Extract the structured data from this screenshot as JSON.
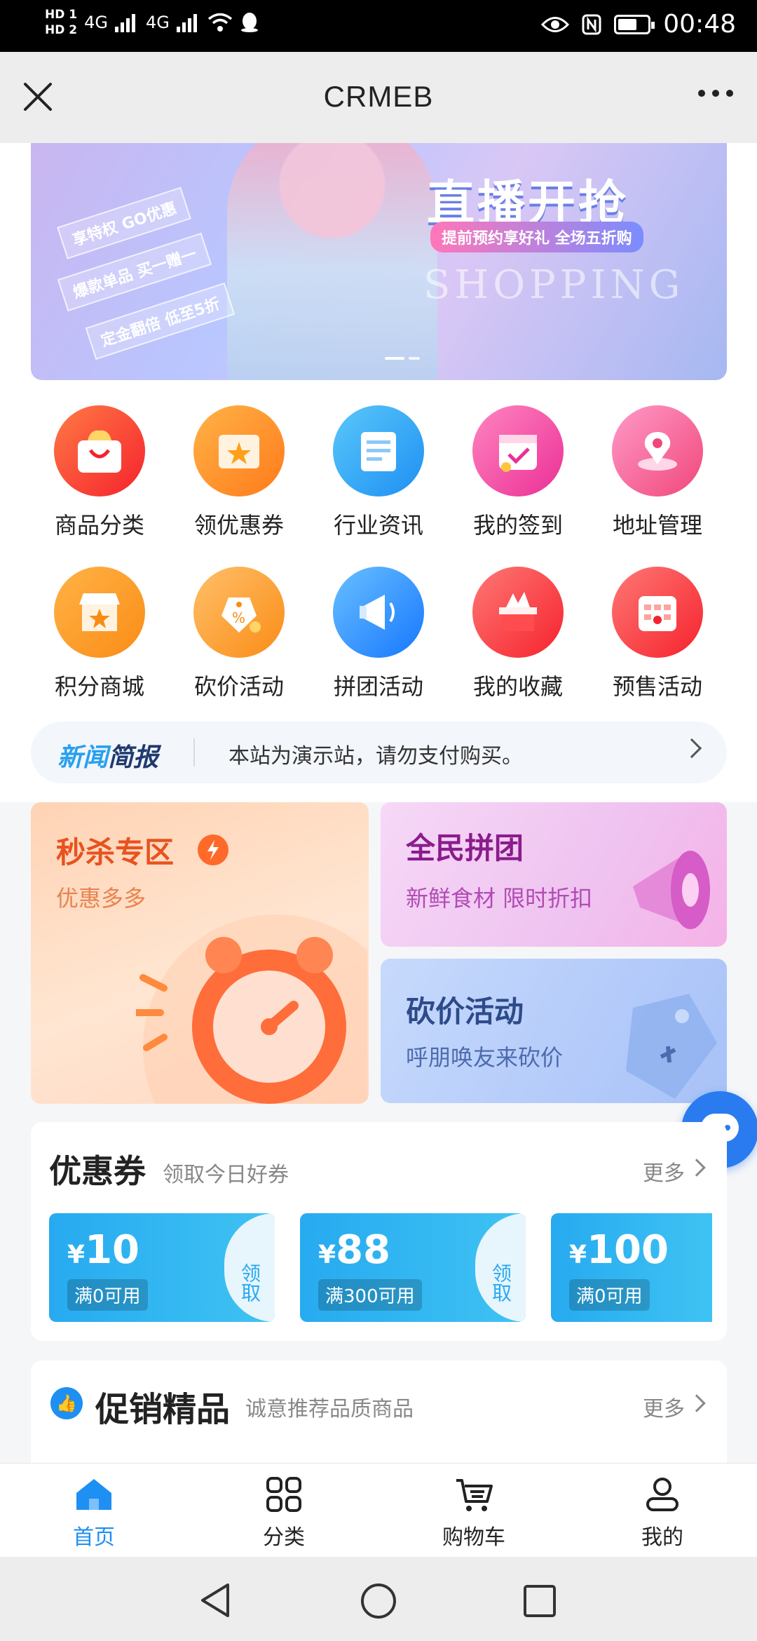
{
  "status_bar": {
    "hd1": "HD 1",
    "hd2": "HD 2",
    "net1": "4G",
    "net2": "4G",
    "time": "00:48",
    "icons": [
      "signal-icon",
      "wifi-icon",
      "qq-icon",
      "eye-icon",
      "nfc-icon",
      "battery-icon"
    ]
  },
  "nav": {
    "title": "CRMEB"
  },
  "banner": {
    "headline": "直播开抢",
    "subline": "提前预约享好礼 全场五折购",
    "tags": [
      "享特权 GO优惠",
      "爆款单品 买一赠一",
      "定金翻倍 低至5折"
    ],
    "english": "SHOPPING"
  },
  "grid": [
    {
      "label": "商品分类",
      "icon": "shopping-bag-icon",
      "color_from": "#ff7a45",
      "color_to": "#f5222d"
    },
    {
      "label": "领优惠券",
      "icon": "coupon-icon",
      "color_from": "#ffb347",
      "color_to": "#ff7a1a"
    },
    {
      "label": "行业资讯",
      "icon": "document-icon",
      "color_from": "#5ac8fa",
      "color_to": "#1e8ff3"
    },
    {
      "label": "我的签到",
      "icon": "calendar-check-icon",
      "color_from": "#ff85c0",
      "color_to": "#eb2f96"
    },
    {
      "label": "地址管理",
      "icon": "map-pin-icon",
      "color_from": "#ff9ac8",
      "color_to": "#f0477a"
    },
    {
      "label": "积分商城",
      "icon": "store-icon",
      "color_from": "#ffb347",
      "color_to": "#fa8c16"
    },
    {
      "label": "砍价活动",
      "icon": "price-tag-icon",
      "color_from": "#ffc069",
      "color_to": "#fa8c16"
    },
    {
      "label": "拼团活动",
      "icon": "megaphone-icon",
      "color_from": "#69c0ff",
      "color_to": "#1677ff"
    },
    {
      "label": "我的收藏",
      "icon": "gift-box-icon",
      "color_from": "#ff7875",
      "color_to": "#f5222d"
    },
    {
      "label": "预售活动",
      "icon": "presale-calendar-icon",
      "color_from": "#ff7875",
      "color_to": "#f5222d"
    }
  ],
  "news": {
    "logo_a": "新闻",
    "logo_b": "简报",
    "text": "本站为演示站，请勿支付购买。"
  },
  "promos": {
    "seckill": {
      "title": "秒杀专区",
      "sub": "优惠多多"
    },
    "group": {
      "title": "全民拼团",
      "sub": "新鲜食材 限时折扣"
    },
    "bargain": {
      "title": "砍价活动",
      "sub": "呼朋唤友来砍价"
    }
  },
  "coupons": {
    "title": "优惠券",
    "sub": "领取今日好券",
    "more": "更多",
    "items": [
      {
        "currency": "¥",
        "amount": "10",
        "cond": "满0可用",
        "take": "领取"
      },
      {
        "currency": "¥",
        "amount": "88",
        "cond": "满300可用",
        "take": "领取"
      },
      {
        "currency": "¥",
        "amount": "100",
        "cond": "满0可用",
        "take": ""
      }
    ]
  },
  "goods": {
    "title": "促销精品",
    "sub": "诚意推荐品质商品",
    "more": "更多"
  },
  "tabs": [
    {
      "label": "首页",
      "icon": "home-icon",
      "active": true
    },
    {
      "label": "分类",
      "icon": "category-grid-icon",
      "active": false
    },
    {
      "label": "购物车",
      "icon": "cart-icon",
      "active": false
    },
    {
      "label": "我的",
      "icon": "user-icon",
      "active": false
    }
  ],
  "colors": {
    "accent": "#1e8ff3",
    "coupon": "#27aaf0"
  }
}
